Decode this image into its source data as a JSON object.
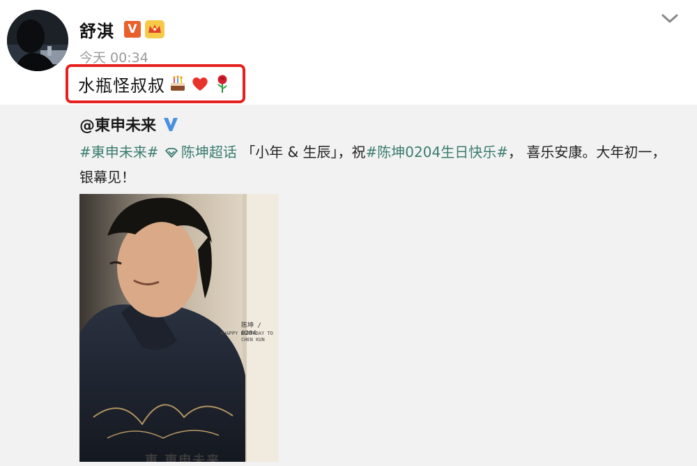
{
  "post": {
    "author_name": "舒淇",
    "verified_badge": "V",
    "time": "今天 00:34",
    "text": "水瓶怪叔叔",
    "emojis": [
      "cake-emoji",
      "heart-emoji",
      "rose-emoji"
    ]
  },
  "repost": {
    "author_name": "@東申未来",
    "text_segments": [
      {
        "type": "hashtag",
        "text": "#東申未来#"
      },
      {
        "type": "plain",
        "text": " "
      },
      {
        "type": "super_topic",
        "text": "陈坤超话"
      },
      {
        "type": "plain",
        "text": " 「小年 & 生辰」，祝"
      },
      {
        "type": "hashtag",
        "text": "#陈坤0204生日快乐#"
      },
      {
        "type": "plain",
        "text": "， 喜乐安康。大年初一，银幕见！"
      }
    ],
    "poster": {
      "credit_line_1": "陈坤 / 0204",
      "credit_line_2": "#HAPPY BIRTHDAY TO",
      "credit_line_3": "CHEN KUN",
      "brand": "東 東申未来"
    }
  },
  "colors": {
    "highlight_border": "#e5201f",
    "hashtag": "#3a7c6f",
    "repost_bg": "#f2f2f2",
    "verified_orange": "#e8602c",
    "verified_blue": "#4a90e2"
  }
}
